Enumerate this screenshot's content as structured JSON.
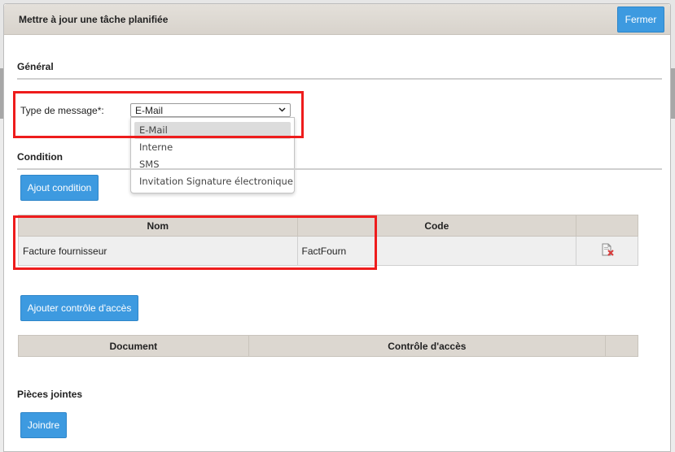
{
  "dialog": {
    "title": "Mettre à jour une tâche planifiée",
    "close_label": "Fermer"
  },
  "general": {
    "section_title": "Général",
    "message_type_label": "Type de message*:",
    "message_type_value": "E-Mail",
    "message_type_options": [
      "E-Mail",
      "Interne",
      "SMS",
      "Invitation Signature électronique"
    ]
  },
  "condition": {
    "section_title": "Condition",
    "add_button_label": "Ajout condition",
    "columns": [
      "Nom",
      "Code",
      ""
    ],
    "rows": [
      {
        "name": "Facture fournisseur",
        "code": "FactFourn"
      }
    ]
  },
  "access": {
    "add_button_label": "Ajouter contrôle d'accès",
    "columns": [
      "Document",
      "Contrôle d'accès",
      ""
    ]
  },
  "attachments": {
    "section_title": "Pièces jointes",
    "join_button_label": "Joindre"
  },
  "icons": {
    "delete_row": "delete-document-icon",
    "select_chevron": "chevron-down-icon"
  },
  "colors": {
    "primary_button": "#3d9ae0",
    "highlight_box": "#ee1c1c",
    "table_header": "#dcd7d0"
  }
}
